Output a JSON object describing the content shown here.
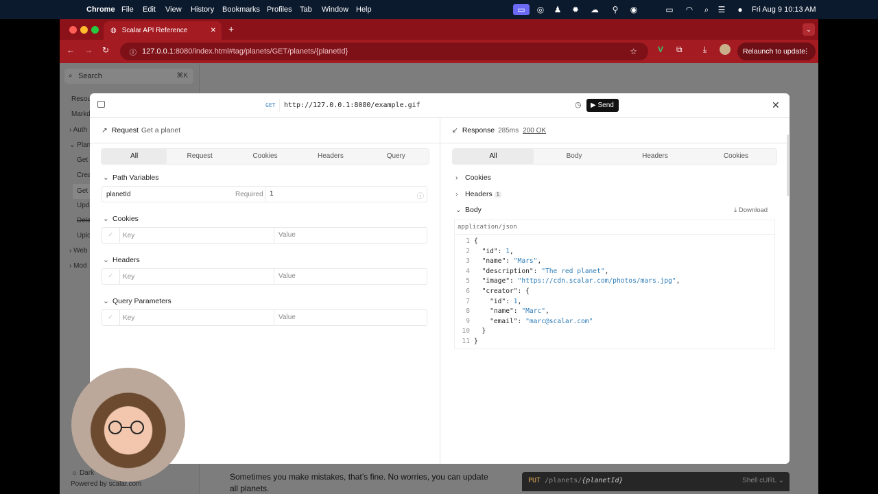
{
  "menubar": {
    "app": "Chrome",
    "items": [
      "File",
      "Edit",
      "View",
      "History",
      "Bookmarks",
      "Profiles",
      "Tab",
      "Window",
      "Help"
    ],
    "clock": "Fri Aug 9  10:13 AM"
  },
  "browser": {
    "tab_title": "Scalar API Reference",
    "url_host": "127.0.0.1",
    "url_rest": ":8080/index.html#tag/planets/GET/planets/{planetId}",
    "relaunch_label": "Relaunch to update"
  },
  "sidebar": {
    "search_placeholder": "Search",
    "search_shortcut": "⌘K",
    "items": [
      "Resou",
      "Markd",
      "Auth",
      "Plan",
      "Get",
      "Crea",
      "Get",
      "Upd",
      "Dele",
      "Uplo",
      "Web",
      "Mod"
    ],
    "theme_label": "Dark",
    "powered": "Powered by scalar.com"
  },
  "page_text": {
    "footer_line1": "Sometimes you make mistakes, that’s fine. No worries, you can update",
    "footer_line2": "all planets.",
    "code_method": "PUT",
    "code_path": "/planets/",
    "code_param": "{planetId}",
    "code_lang": "Shell cURL"
  },
  "modal": {
    "method": "GET",
    "url": "http://127.0.0.1:8080/example.gif",
    "send_label": "Send",
    "request": {
      "title": "Request",
      "subtitle": "Get a planet",
      "tabs": [
        "All",
        "Request",
        "Cookies",
        "Headers",
        "Query"
      ],
      "active_tab": "All",
      "sections": {
        "path": "Path Variables",
        "cookies": "Cookies",
        "headers": "Headers",
        "query": "Query Parameters"
      },
      "path_var": {
        "name": "planetId",
        "required": "Required",
        "value": "1"
      },
      "key_placeholder": "Key",
      "value_placeholder": "Value"
    },
    "response": {
      "title": "Response",
      "time": "285ms",
      "status": "200 OK",
      "tabs": [
        "All",
        "Body",
        "Headers",
        "Cookies"
      ],
      "active_tab": "All",
      "cookies_label": "Cookies",
      "headers_label": "Headers",
      "headers_count": "1",
      "body_label": "Body",
      "download_label": "Download",
      "content_type": "application/json",
      "code_lines": [
        "{",
        "  \"id\": 1,",
        "  \"name\": \"Mars\",",
        "  \"description\": \"The red planet\",",
        "  \"image\": \"https://cdn.scalar.com/photos/mars.jpg\",",
        "  \"creator\": {",
        "    \"id\": 1,",
        "    \"name\": \"Marc\",",
        "    \"email\": \"marc@scalar.com\"",
        "  }",
        "}"
      ]
    }
  }
}
